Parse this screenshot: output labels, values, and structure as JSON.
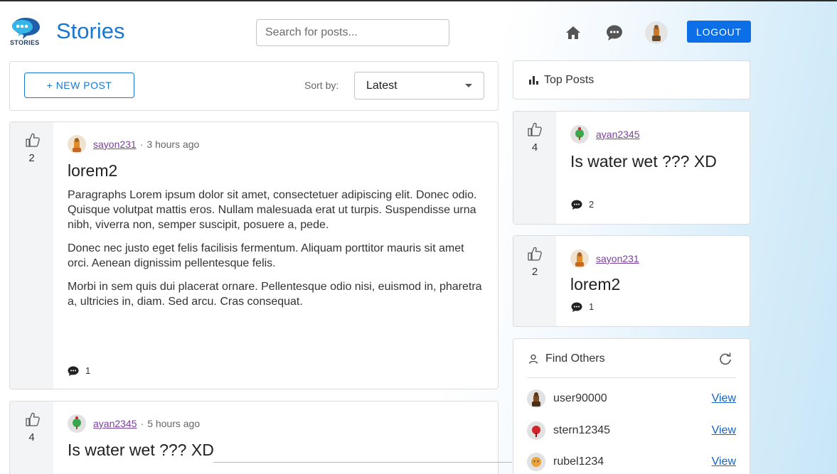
{
  "header": {
    "brand": "Stories",
    "logo_text": "STORIES",
    "search_placeholder": "Search for posts...",
    "logout_label": "LOGOUT",
    "icons": [
      "home-icon",
      "chat-icon",
      "user-avatar"
    ]
  },
  "toolbar": {
    "new_post_label": "+ NEW POST",
    "sort_label": "Sort by:",
    "sort_value": "Latest"
  },
  "posts": [
    {
      "votes": "2",
      "author": "sayon231",
      "separator": "·",
      "time": "3 hours ago",
      "title": "lorem2",
      "paragraphs": [
        "Paragraphs Lorem ipsum dolor sit amet, consectetuer adipiscing elit. Donec odio. Quisque volutpat mattis eros. Nullam malesuada erat ut turpis. Suspendisse urna nibh, viverra non, semper suscipit, posuere a, pede.",
        "Donec nec justo eget felis facilisis fermentum. Aliquam porttitor mauris sit amet orci. Aenean dignissim pellentesque felis.",
        "Morbi in sem quis dui placerat ornare. Pellentesque odio nisi, euismod in, pharetra a, ultricies in, diam. Sed arcu. Cras consequat."
      ],
      "comments": "1"
    },
    {
      "votes": "4",
      "author": "ayan2345",
      "separator": "·",
      "time": "5 hours ago",
      "title": "Is water wet ??? XD"
    }
  ],
  "sidebar": {
    "top_posts_title": "Top Posts",
    "top_posts": [
      {
        "votes": "4",
        "author": "ayan2345",
        "title": "Is water wet ??? XD",
        "comments": "2"
      },
      {
        "votes": "2",
        "author": "sayon231",
        "title": "lorem2",
        "comments": "1"
      }
    ],
    "find_title": "Find Others",
    "users": [
      {
        "name": "user90000",
        "action": "View"
      },
      {
        "name": "stern12345",
        "action": "View"
      },
      {
        "name": "rubel1234",
        "action": "View"
      }
    ]
  },
  "colors": {
    "brand": "#1976d2",
    "logout_bg": "#0d6fe8",
    "author_link": "#7b3fa0",
    "view_link": "#1565c0"
  }
}
